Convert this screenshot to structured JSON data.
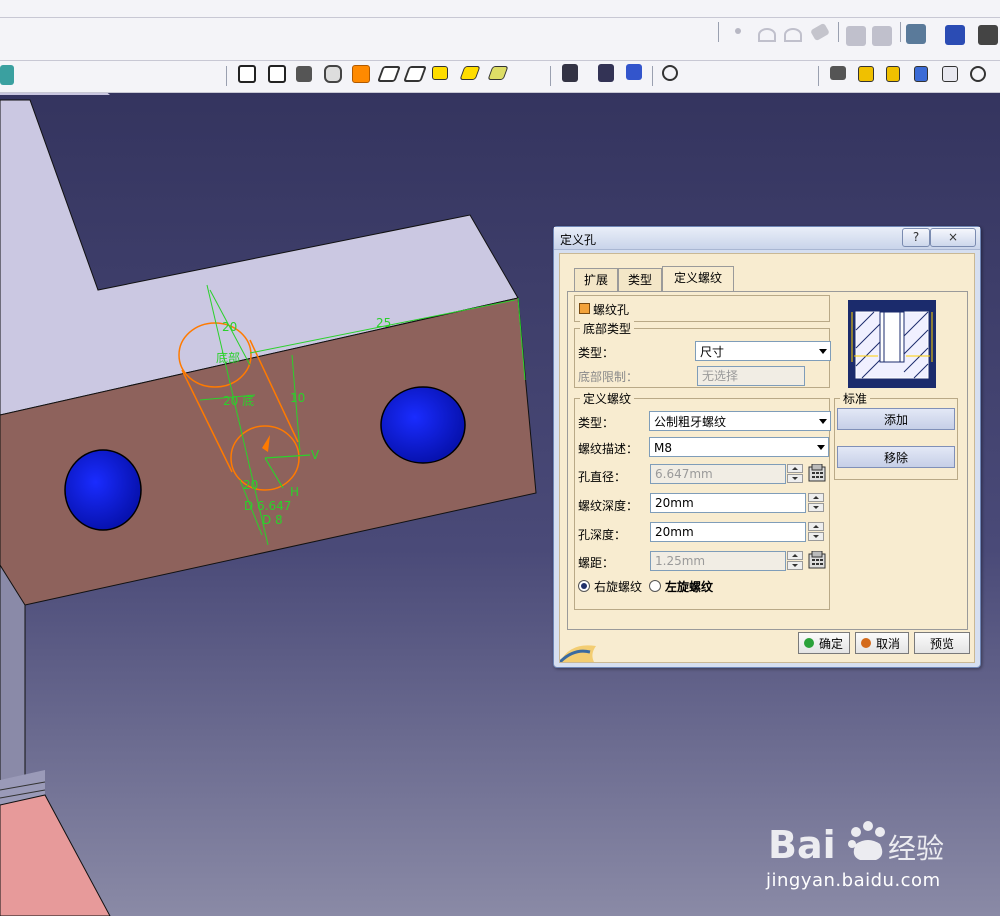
{
  "dialog": {
    "title": "定义孔",
    "help_label": "?",
    "close_label": "×",
    "tabs": [
      {
        "label": "扩展",
        "active": false
      },
      {
        "label": "类型",
        "active": false
      },
      {
        "label": "定义螺纹",
        "active": true
      }
    ],
    "threaded_checkbox_label": "螺纹孔",
    "bottom_group": {
      "title": "底部类型",
      "type_label": "类型：",
      "type_value": "尺寸",
      "limit_label": "底部限制：",
      "limit_value": "无选择"
    },
    "thread_group": {
      "title": "定义螺纹",
      "type_label": "类型：",
      "type_value": "公制粗牙螺纹",
      "desc_label": "螺纹描述：",
      "desc_value": "M8",
      "hole_dia_label": "孔直径：",
      "hole_dia_value": "6.647mm",
      "thread_depth_label": "螺纹深度：",
      "thread_depth_value": "20mm",
      "hole_depth_label": "孔深度：",
      "hole_depth_value": "20mm",
      "pitch_label": "螺距：",
      "pitch_value": "1.25mm",
      "right_thread_label": "右旋螺纹",
      "left_thread_label": "左旋螺纹",
      "selected_direction": "right"
    },
    "standard_group": {
      "title": "标准",
      "add_label": "添加",
      "remove_label": "移除"
    },
    "footer": {
      "ok_label": "确定",
      "cancel_label": "取消",
      "preview_label": "预览"
    }
  },
  "viewport_annotations": {
    "dim_20_top": "20",
    "dim_bottom_label": "底部",
    "dim_25": "25",
    "dim_20_depth": "20 底",
    "dim_10": "10",
    "dim_v": "V",
    "dim_h": "H",
    "dim_d_647": "D 6.647",
    "dim_d_8": "D 8",
    "dim_20_side": "20"
  },
  "watermark": {
    "brand": "Bai",
    "brand_suffix": "经验",
    "url": "jingyan.baidu.com"
  },
  "colors": {
    "background": "#3a3a66",
    "dialog_body": "#f8ecd0",
    "part_face_top": "#c9c6e0",
    "part_face_front": "#8e625c",
    "hole_blue": "#0b17d6",
    "sketch_green": "#2bd12b",
    "sketch_orange": "#ff7a00"
  }
}
